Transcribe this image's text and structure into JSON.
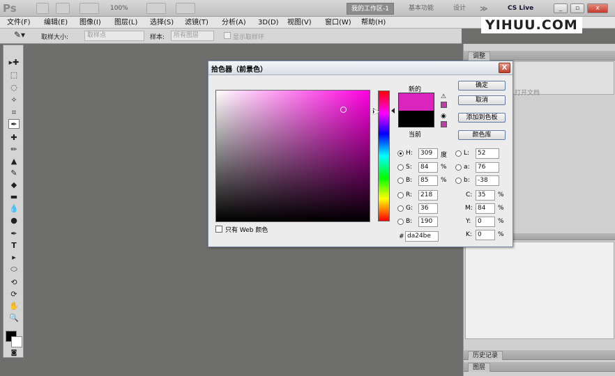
{
  "app": {
    "logo": "Ps",
    "zoom": "100%",
    "workspaces": [
      "我的工作区-1",
      "基本功能",
      "设计"
    ],
    "more": "≫",
    "cslive": "CS Live"
  },
  "watermark": "YIHUU.COM",
  "menu": [
    "文件(F)",
    "编辑(E)",
    "图像(I)",
    "图层(L)",
    "选择(S)",
    "滤镜(T)",
    "分析(A)",
    "3D(D)",
    "视图(V)",
    "窗口(W)",
    "帮助(H)"
  ],
  "options": {
    "sample_size_label": "取样大小:",
    "sample_size_value": "取样点",
    "sample_label": "样本:",
    "sample_value": "所有图层",
    "show_ring_label": "显示取样环"
  },
  "right_panel": {
    "adjust_tab": "调整",
    "adjust_text": "打开文档",
    "history_tab": "历史记录",
    "layers_tab": "图层"
  },
  "dialog": {
    "title": "拾色器（前景色）",
    "close": "X",
    "new_label": "新的",
    "current_label": "当前",
    "buttons": {
      "ok": "确定",
      "cancel": "取消",
      "add_swatch": "添加到色板",
      "color_library": "颜色库"
    },
    "hsb": {
      "h_label": "H:",
      "h": "309",
      "h_unit": "度",
      "s_label": "S:",
      "s": "84",
      "s_unit": "%",
      "b_label": "B:",
      "b": "85",
      "b_unit": "%"
    },
    "lab": {
      "l_label": "L:",
      "l": "52",
      "a_label": "a:",
      "a": "76",
      "b_label": "b:",
      "b": "-38"
    },
    "rgb": {
      "r_label": "R:",
      "r": "218",
      "g_label": "G:",
      "g": "36",
      "b_label": "B:",
      "b": "190"
    },
    "cmyk": {
      "c_label": "C:",
      "c": "35",
      "m_label": "M:",
      "m": "84",
      "y_label": "Y:",
      "y": "0",
      "k_label": "K:",
      "k": "0",
      "unit": "%"
    },
    "hex_label": "#",
    "hex": "da24be",
    "web_only_label": "只有 Web 颜色"
  },
  "colors": {
    "new_color": "#da24be",
    "current_color": "#000000"
  }
}
